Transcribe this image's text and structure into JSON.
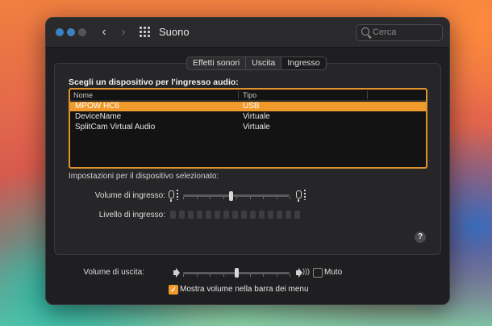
{
  "window": {
    "title": "Suono"
  },
  "search": {
    "placeholder": "Cerca"
  },
  "tabs": [
    {
      "label": "Effetti sonori",
      "selected": false
    },
    {
      "label": "Uscita",
      "selected": false
    },
    {
      "label": "Ingresso",
      "selected": true
    }
  ],
  "input_section": {
    "title": "Scegli un dispositivo per l'ingresso audio:",
    "columns": [
      "Nome",
      "Tipo"
    ],
    "devices": [
      {
        "name": "MPOW HC6",
        "type": "USB",
        "selected": true
      },
      {
        "name": "DeviceName",
        "type": "Virtuale",
        "selected": false
      },
      {
        "name": "SplitCam Virtual Audio",
        "type": "Virtuale",
        "selected": false
      }
    ]
  },
  "settings": {
    "title": "Impostazioni per il dispositivo selezionato:",
    "input_volume_label": "Volume di ingresso:",
    "input_volume_level": 0.45,
    "input_level_label": "Livello di ingresso:",
    "input_level_segments_lit": 0
  },
  "help": {
    "label": "?"
  },
  "output": {
    "volume_label": "Volume di uscita:",
    "volume_level": 0.5,
    "mute_label": "Muto",
    "mute_checked": false,
    "menubar_label": "Mostra volume nella barra dei menu",
    "menubar_checked": true
  },
  "colors": {
    "accent": "#f09a2c",
    "window_bg": "#1f1f21"
  }
}
